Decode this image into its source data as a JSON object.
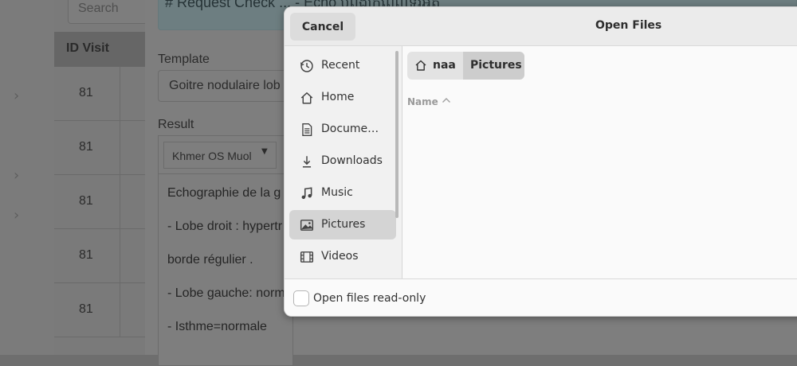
{
  "background": {
    "search": {
      "placeholder": "Search"
    },
    "table": {
      "header": "ID Visit",
      "rows": [
        "81",
        "81",
        "81",
        "81",
        "81"
      ]
    },
    "request_banner": "# Request Check ... - Echo បំពង់ក្រពេញទីរ៉ូអ៊ីត",
    "template": {
      "label": "Template",
      "value": "Goitre nodulaire lob"
    },
    "result": {
      "label": "Result",
      "font": "Khmer OS Muol",
      "lines": [
        "Echographie de la g",
        "- Lobe droit : hypertr",
        "borde régulier .",
        "- Lobe gauche: norm",
        "- Isthme=normale"
      ]
    }
  },
  "dialog": {
    "title": "Open Files",
    "cancel_label": "Cancel",
    "places": [
      {
        "label": "Recent",
        "icon": "clock-icon"
      },
      {
        "label": "Home",
        "icon": "home-icon"
      },
      {
        "label": "Docume…",
        "icon": "document-icon"
      },
      {
        "label": "Downloads",
        "icon": "download-icon"
      },
      {
        "label": "Music",
        "icon": "music-note-icon"
      },
      {
        "label": "Pictures",
        "icon": "image-icon",
        "selected": true
      },
      {
        "label": "Videos",
        "icon": "film-icon"
      }
    ],
    "pathbar": {
      "home": "naa",
      "current": "Pictures"
    },
    "column_name": "Name",
    "readonly_label": "Open files read-only"
  }
}
